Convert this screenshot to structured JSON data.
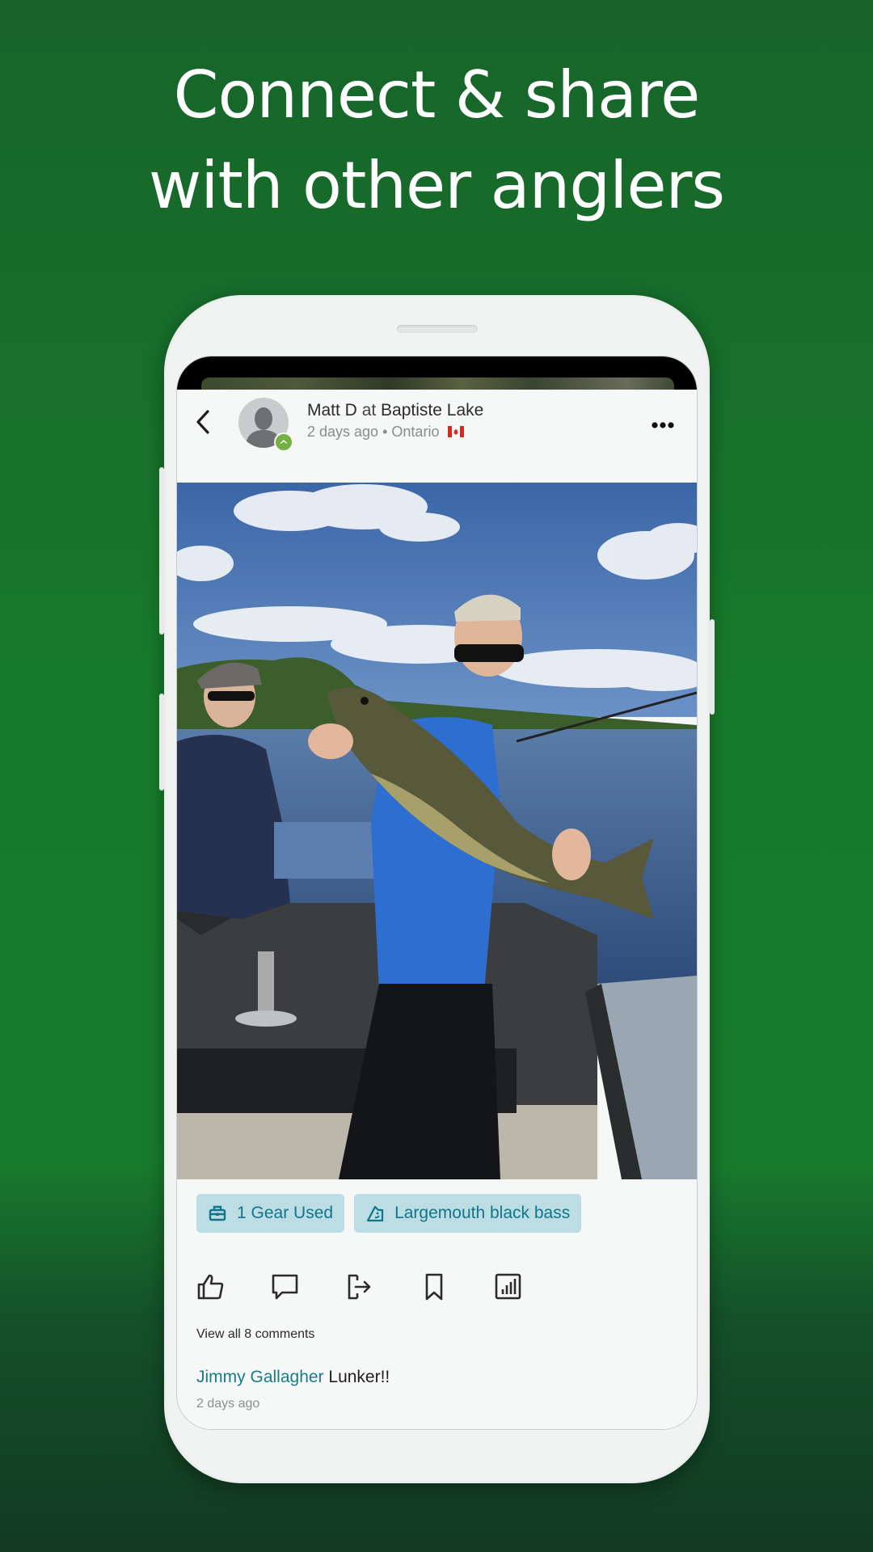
{
  "headline": {
    "line1": "Connect & share",
    "line2": "with other anglers"
  },
  "colors": {
    "background": "#177a2b",
    "accent": "#1a7b8c",
    "tag_bg": "#bcdde3",
    "tag_text": "#137589",
    "badge": "#74b044"
  },
  "post": {
    "author": "Matt D",
    "at_word": "at",
    "location": "Baptiste Lake",
    "time": "2 days ago",
    "separator": "•",
    "region": "Ontario",
    "country_flag": "canada-flag",
    "back_icon": "chevron-left-icon",
    "more_icon": "more-horizontal-icon",
    "photo_alt": "Angler holding a largemouth bass on a boat"
  },
  "tags": [
    {
      "icon": "tackle-box-icon",
      "label": "1 Gear Used"
    },
    {
      "icon": "fish-species-icon",
      "label": "Largemouth black bass"
    }
  ],
  "actions": [
    {
      "icon": "thumbs-up-icon",
      "label": "Like"
    },
    {
      "icon": "comment-icon",
      "label": "Comment"
    },
    {
      "icon": "share-icon",
      "label": "Share"
    },
    {
      "icon": "bookmark-icon",
      "label": "Save"
    },
    {
      "icon": "stats-icon",
      "label": "Stats"
    }
  ],
  "comments": {
    "view_all": "View all 8 comments",
    "latest": {
      "author": "Jimmy Gallagher",
      "text": "Lunker!!",
      "time": "2 days ago"
    }
  }
}
